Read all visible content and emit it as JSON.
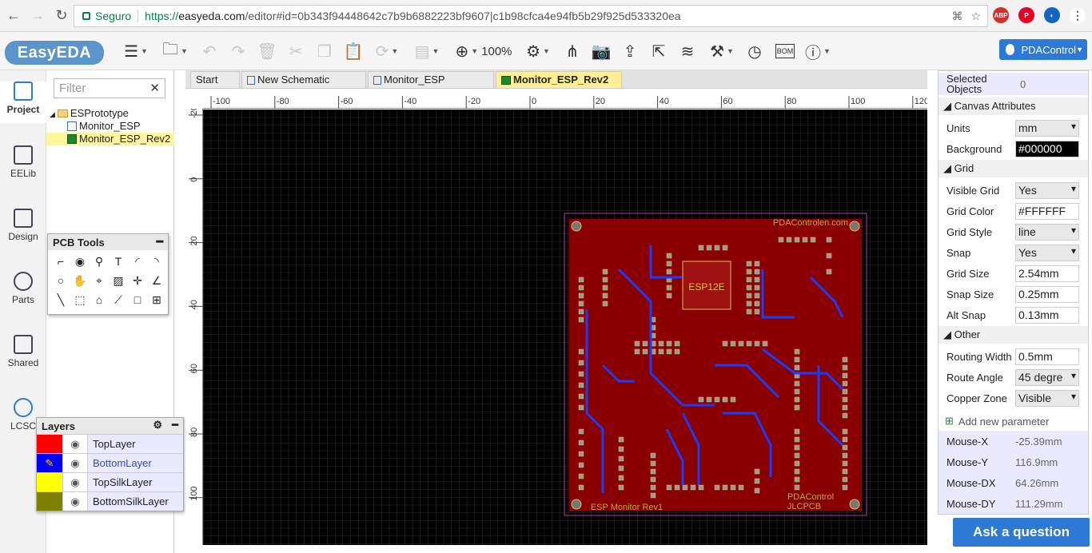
{
  "browser": {
    "secure_label": "Seguro",
    "url_proto": "https://",
    "url_host": "easyeda.com",
    "url_path": "/editor#id=0b343f94448642c7b9b6882223bf9607|c1b98cfca4e94fb5b29f925d533320ea"
  },
  "app": {
    "logo": "EasyEDA",
    "zoom": "100%",
    "user": "PDAControl"
  },
  "rail": {
    "items": [
      {
        "label": "Project",
        "icon": "project-icon"
      },
      {
        "label": "EELib",
        "icon": "eelib-icon"
      },
      {
        "label": "Design",
        "icon": "design-icon"
      },
      {
        "label": "Parts",
        "icon": "parts-icon"
      },
      {
        "label": "Shared",
        "icon": "shared-icon"
      },
      {
        "label": "LCSC",
        "icon": "lcsc-icon"
      }
    ]
  },
  "tree": {
    "filter_placeholder": "Filter",
    "project": "ESPrototype",
    "files": [
      "Monitor_ESP",
      "Monitor_ESP_Rev2"
    ]
  },
  "pcb_tools": {
    "title": "PCB Tools"
  },
  "layers": {
    "title": "Layers",
    "items": [
      {
        "name": "TopLayer",
        "color": "#ff0000"
      },
      {
        "name": "BottomLayer",
        "color": "#0000ff"
      },
      {
        "name": "TopSilkLayer",
        "color": "#ffff00"
      },
      {
        "name": "BottomSilkLayer",
        "color": "#808000"
      }
    ]
  },
  "tabs": [
    "Start",
    "New Schematic",
    "Monitor_ESP",
    "Monitor_ESP_Rev2"
  ],
  "rulers": {
    "h": [
      "-100",
      "-80",
      "-60",
      "-40",
      "-20",
      "0",
      "20",
      "40",
      "60",
      "80",
      "100",
      "120"
    ],
    "v": [
      "-20",
      "0",
      "20",
      "40",
      "60",
      "80",
      "100"
    ]
  },
  "board": {
    "silk_top": "PDAControlen.com",
    "chip": "ESP12E",
    "footer_left": "ESP Monitor Rev1",
    "footer_right1": "PDAControl",
    "footer_right2": "JLCPCB"
  },
  "props": {
    "selected_objects_label": "Selected Objects",
    "selected_objects_value": "0",
    "canvas_section": "Canvas Attributes",
    "units_label": "Units",
    "units_value": "mm",
    "background_label": "Background",
    "background_value": "#000000",
    "grid_section": "Grid",
    "visible_grid_label": "Visible Grid",
    "visible_grid_value": "Yes",
    "grid_color_label": "Grid Color",
    "grid_color_value": "#FFFFFF",
    "grid_style_label": "Grid Style",
    "grid_style_value": "line",
    "snap_label": "Snap",
    "snap_value": "Yes",
    "grid_size_label": "Grid Size",
    "grid_size_value": "2.54mm",
    "snap_size_label": "Snap Size",
    "snap_size_value": "0.25mm",
    "alt_snap_label": "Alt Snap",
    "alt_snap_value": "0.13mm",
    "other_section": "Other",
    "routing_width_label": "Routing Width",
    "routing_width_value": "0.5mm",
    "route_angle_label": "Route Angle",
    "route_angle_value": "45 degre",
    "copper_zone_label": "Copper Zone",
    "copper_zone_value": "Visible",
    "add_param": "Add new parameter",
    "mouse_x_label": "Mouse-X",
    "mouse_x_value": "-25.39mm",
    "mouse_y_label": "Mouse-Y",
    "mouse_y_value": "116.9mm",
    "mouse_dx_label": "Mouse-DX",
    "mouse_dx_value": "64.26mm",
    "mouse_dy_label": "Mouse-DY",
    "mouse_dy_value": "111.29mm"
  },
  "ask_button": "Ask a question"
}
